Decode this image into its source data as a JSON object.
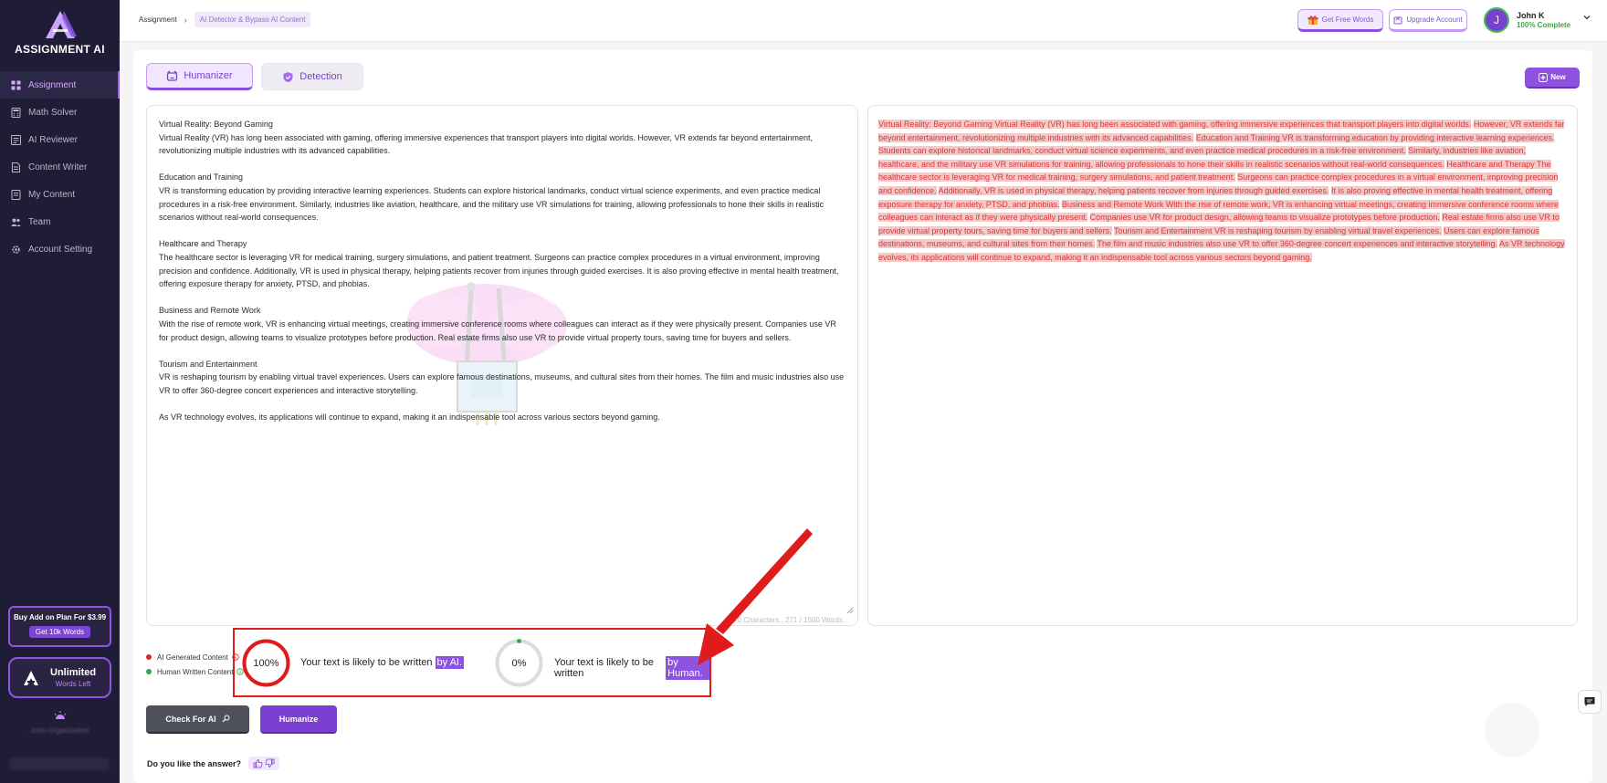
{
  "app": {
    "logo_letter": "A",
    "logo_text": "ASSIGNMENT AI"
  },
  "sidebar": {
    "items": [
      {
        "label": "Assignment",
        "icon": "grid-icon",
        "active": true
      },
      {
        "label": "Math Solver",
        "icon": "calculator-icon",
        "active": false
      },
      {
        "label": "AI Reviewer",
        "icon": "review-icon",
        "active": false
      },
      {
        "label": "Content Writer",
        "icon": "document-icon",
        "active": false
      },
      {
        "label": "My Content",
        "icon": "folder-icon",
        "active": false
      },
      {
        "label": "Team",
        "icon": "team-icon",
        "active": false
      },
      {
        "label": "Account Setting",
        "icon": "gear-icon",
        "active": false
      }
    ],
    "addon": {
      "title": "Buy Add on Plan For $3.99",
      "button": "Get 10k Words"
    },
    "plan": {
      "title": "Unlimited",
      "subtitle": "Words Left"
    },
    "org_name": "John Organization"
  },
  "topbar": {
    "breadcrumb": {
      "root": "Assignment",
      "separator": "›",
      "current": "AI Detector & Bypass AI Content"
    },
    "free_words": "Get Free Words",
    "upgrade": "Upgrade Account",
    "user": {
      "initial": "J",
      "name": "John K",
      "status": "100% Complete"
    }
  },
  "tabs": {
    "humanizer": "Humanizer",
    "detection": "Detection",
    "new_button": "New"
  },
  "editor": {
    "paragraphs": [
      {
        "heading": "Virtual Reality: Beyond Gaming",
        "body": "Virtual Reality (VR) has long been associated with gaming, offering immersive experiences that transport players into digital worlds. However, VR extends far beyond entertainment, revolutionizing multiple industries with its advanced capabilities."
      },
      {
        "heading": "Education and Training",
        "body": "VR is transforming education by providing interactive learning experiences. Students can explore historical landmarks, conduct virtual science experiments, and even practice medical procedures in a risk-free environment. Similarly, industries like aviation, healthcare, and the military use VR simulations for training, allowing professionals to hone their skills in realistic scenarios without real-world consequences."
      },
      {
        "heading": "Healthcare and Therapy",
        "body": "The healthcare sector is leveraging VR for medical training, surgery simulations, and patient treatment. Surgeons can practice complex procedures in a virtual environment, improving precision and confidence. Additionally, VR is used in physical therapy, helping patients recover from injuries through guided exercises. It is also proving effective in mental health treatment, offering exposure therapy for anxiety, PTSD, and phobias."
      },
      {
        "heading": "Business and Remote Work",
        "body": "With the rise of remote work, VR is enhancing virtual meetings, creating immersive conference rooms where colleagues can interact as if they were physically present. Companies use VR for product design, allowing teams to visualize prototypes before production. Real estate firms also use VR to provide virtual property tours, saving time for buyers and sellers."
      },
      {
        "heading": "Tourism and Entertainment",
        "body": "VR is reshaping tourism by enabling virtual travel experiences. Users can explore famous destinations, museums, and cultural sites from their homes. The film and music industries also use VR to offer 360-degree concert experiences and interactive storytelling."
      },
      {
        "heading": "",
        "body": "As VR technology evolves, its applications will continue to expand, making it an indispensable tool across various sectors beyond gaming."
      }
    ],
    "char_count": "1670 Characters , 271 / 1500 Words"
  },
  "output": {
    "segments": [
      "Virtual Reality: Beyond Gaming Virtual Reality (VR) has long been associated with gaming, offering immersive experiences that transport players into digital worlds.",
      "However, VR extends far beyond entertainment, revolutionizing multiple industries with its advanced capabilities.",
      "Education and Training VR is transforming education by providing interactive learning experiences.",
      "Students can explore historical landmarks, conduct virtual science experiments, and even practice medical procedures in a risk-free environment.",
      "Similarly, industries like aviation, healthcare, and the military use VR simulations for training, allowing professionals to hone their skills in realistic scenarios without real-world consequences.",
      "Healthcare and Therapy The healthcare sector is leveraging VR for medical training, surgery simulations, and patient treatment.",
      "Surgeons can practice complex procedures in a virtual environment, improving precision and confidence.",
      "Additionally, VR is used in physical therapy, helping patients recover from injuries through guided exercises.",
      "It is also proving effective in mental health treatment, offering exposure therapy for anxiety, PTSD, and phobias.",
      "Business and Remote Work With the rise of remote work, VR is enhancing virtual meetings, creating immersive conference rooms where colleagues can interact as if they were physically present.",
      "Companies use VR for product design, allowing teams to visualize prototypes before production.",
      "Real estate firms also use VR to provide virtual property tours, saving time for buyers and sellers.",
      "Tourism and Entertainment VR is reshaping tourism by enabling virtual travel experiences.",
      "Users can explore famous destinations, museums, and cultural sites from their homes.",
      "The film and music industries also use VR to offer 360-degree concert experiences and interactive storytelling.",
      "As VR technology evolves, its applications will continue to expand, making it an indispensable tool across various sectors beyond gaming."
    ]
  },
  "legend": {
    "ai": "AI Generated Content",
    "human": "Human Written Content",
    "ai_color": "#e02424",
    "human_color": "#2fa84f"
  },
  "results": {
    "ai_percent": 100,
    "ai_label": "100%",
    "ai_text": "Your text is likely to be written",
    "ai_tag": "by AI.",
    "human_percent": 0,
    "human_label": "0%",
    "human_text": "Your text is likely to be written",
    "human_tag": "by Human."
  },
  "actions": {
    "check": "Check For AI",
    "humanize": "Humanize",
    "feedback": "Do you like the answer?"
  },
  "colors": {
    "accent": "#7a3fd1",
    "sidebar_bg": "#1f1d36",
    "highlight_red": "#e01b1b"
  }
}
